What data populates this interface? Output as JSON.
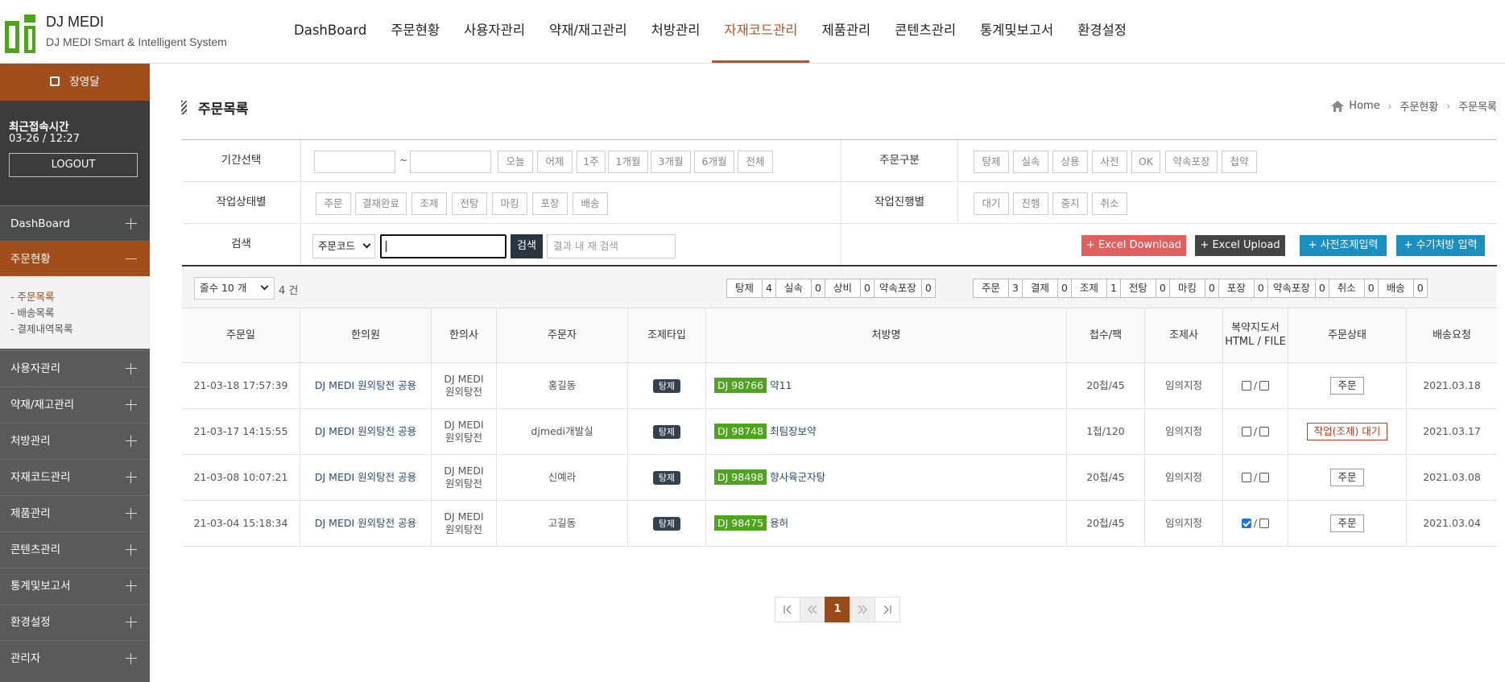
{
  "header": {
    "logo_title": "DJ MEDI",
    "logo_subtitle": "DJ MEDI Smart & Intelligent System",
    "nav": [
      "DashBoard",
      "주문현황",
      "사용자관리",
      "약재/재고관리",
      "처방관리",
      "자재코드관리",
      "제품관리",
      "콘텐츠관리",
      "통계및보고서",
      "환경설정"
    ],
    "active_nav_index": 5,
    "accent_color": "#c0501c"
  },
  "sidebar": {
    "user_name": "장영달",
    "last_login_label": "최근접속시간",
    "last_login_time": "03-26 / 12:27",
    "logout_label": "LOGOUT",
    "menu": [
      "DashBoard",
      "주문현황",
      "사용자관리",
      "약재/재고관리",
      "처방관리",
      "자재코드관리",
      "제품관리",
      "콘텐츠관리",
      "통계및보고서",
      "환경설정",
      "관리자"
    ],
    "active_menu_index": 1,
    "submenu": [
      "주문목록",
      "배송목록",
      "결제내역목록"
    ],
    "active_submenu_index": 0
  },
  "page": {
    "title": "주문목록",
    "breadcrumb": [
      "Home",
      "주문현황",
      "주문목록"
    ]
  },
  "search": {
    "period_label": "기간선택",
    "date_sep": "~",
    "period_chips": [
      "오늘",
      "어제",
      "1주",
      "1개월",
      "3개월",
      "6개월",
      "전체"
    ],
    "order_type_label": "주문구분",
    "order_type_chips": [
      "탕제",
      "실속",
      "상용",
      "사전",
      "OK",
      "약속포장",
      "첩약"
    ],
    "work_status_label": "작업상태별",
    "work_status_chips": [
      "주문",
      "결재완료",
      "조제",
      "전탕",
      "마킹",
      "포장",
      "배송"
    ],
    "work_progress_label": "작업진행별",
    "work_progress_chips": [
      "대기",
      "진행",
      "중지",
      "취소"
    ],
    "search_label": "검색",
    "search_select": "주문코드",
    "search_button": "검색",
    "research_placeholder": "결과 내 재 검색",
    "buttons": {
      "excel_download": "+ Excel Download",
      "excel_upload": "+ Excel Upload",
      "pre_prep": "+ 사전조제입력",
      "manual_rx": "+ 수기처방 입력"
    }
  },
  "summary": {
    "rows_select": "줄수 10 개",
    "total": "4 건",
    "type_stats": [
      [
        "탕제",
        "4"
      ],
      [
        "실속",
        "0"
      ],
      [
        "상비",
        "0"
      ],
      [
        "약속포장",
        "0"
      ]
    ],
    "status_stats": [
      [
        "주문",
        "3"
      ],
      [
        "결제",
        "0"
      ],
      [
        "조제",
        "1"
      ],
      [
        "전탕",
        "0"
      ],
      [
        "마킹",
        "0"
      ],
      [
        "포장",
        "0"
      ],
      [
        "약속포장",
        "0"
      ],
      [
        "취소",
        "0"
      ],
      [
        "배송",
        "0"
      ]
    ]
  },
  "table": {
    "headers": [
      "주문일",
      "한의원",
      "한의사",
      "주문자",
      "조제타입",
      "처방명",
      "첩수/팩",
      "조제사",
      "복약지도서",
      "HTML / FILE",
      "주문상태",
      "배송요청"
    ],
    "rows": [
      {
        "date": "21-03-18 17:57:39",
        "clinic": "DJ MEDI 원외탕전 공용",
        "doctor1": "DJ MEDI",
        "doctor2": "원외탕전",
        "orderer": "홍길동",
        "type": "탕제",
        "rx_code": "DJ 98766",
        "rx_name": "약11",
        "packs": "20첩/45",
        "pharmacist": "임의지정",
        "html_checked": false,
        "file_checked": false,
        "status": "주문",
        "delivery": "2021.03.18"
      },
      {
        "date": "21-03-17 14:15:55",
        "clinic": "DJ MEDI 원외탕전 공용",
        "doctor1": "DJ MEDI",
        "doctor2": "원외탕전",
        "orderer": "djmedi개발실",
        "type": "탕제",
        "rx_code": "DJ 98748",
        "rx_name": "최팀장보약",
        "packs": "1첩/120",
        "pharmacist": "임의지정",
        "html_checked": false,
        "file_checked": false,
        "status": "작업(조제) 대기",
        "delivery": "2021.03.17"
      },
      {
        "date": "21-03-08 10:07:21",
        "clinic": "DJ MEDI 원외탕전 공용",
        "doctor1": "DJ MEDI",
        "doctor2": "원외탕전",
        "orderer": "신예라",
        "type": "탕제",
        "rx_code": "DJ 98498",
        "rx_name": "향사육군자탕",
        "packs": "20첩/45",
        "pharmacist": "임의지정",
        "html_checked": false,
        "file_checked": false,
        "status": "주문",
        "delivery": "2021.03.08"
      },
      {
        "date": "21-03-04 15:18:34",
        "clinic": "DJ MEDI 원외탕전 공용",
        "doctor1": "DJ MEDI",
        "doctor2": "원외탕전",
        "orderer": "고길동",
        "type": "탕제",
        "rx_code": "DJ 98475",
        "rx_name": "용허",
        "packs": "20첩/45",
        "pharmacist": "임의지정",
        "html_checked": true,
        "file_checked": false,
        "status": "주문",
        "delivery": "2021.03.04"
      }
    ]
  },
  "pagination": {
    "current": "1"
  }
}
